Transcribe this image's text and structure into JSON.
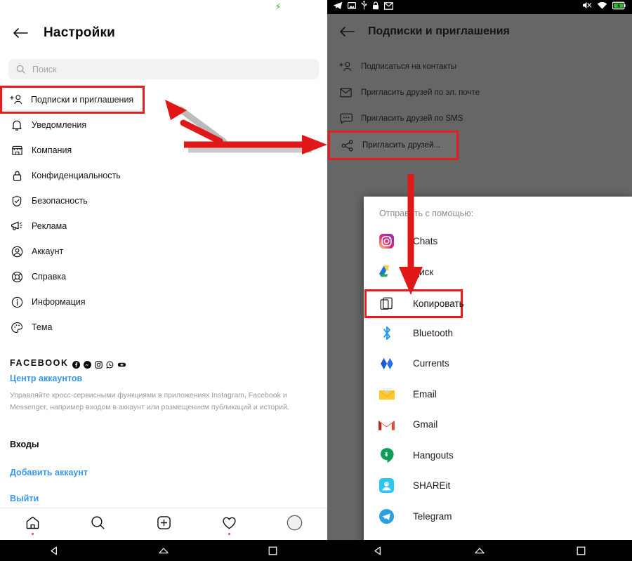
{
  "left_panel": {
    "status_bar": {
      "charge_icon": "charging-bolt-icon"
    },
    "header": {
      "back_icon": "back-arrow-icon",
      "title": "Настройки"
    },
    "search": {
      "icon": "search-icon",
      "placeholder": "Поиск"
    },
    "menu_items": [
      {
        "icon": "add-person-icon",
        "label": "Подписки и приглашения",
        "highlighted": true
      },
      {
        "icon": "bell-icon",
        "label": "Уведомления"
      },
      {
        "icon": "store-icon",
        "label": "Компания"
      },
      {
        "icon": "lock-icon",
        "label": "Конфиденциальность"
      },
      {
        "icon": "shield-check-icon",
        "label": "Безопасность"
      },
      {
        "icon": "megaphone-icon",
        "label": "Реклама"
      },
      {
        "icon": "account-circle-icon",
        "label": "Аккаунт"
      },
      {
        "icon": "lifebuoy-icon",
        "label": "Справка"
      },
      {
        "icon": "info-circle-icon",
        "label": "Информация"
      },
      {
        "icon": "palette-icon",
        "label": "Тема"
      }
    ],
    "facebook": {
      "word": "FACEBOOK",
      "brand_icons": [
        "facebook-icon",
        "messenger-icon",
        "instagram-icon",
        "whatsapp-icon",
        "oculus-icon"
      ],
      "link": "Центр аккаунтов",
      "description": "Управляйте кросс-сервисными функциями в приложениях Instagram, Facebook и Messenger, например входом в аккаунт или размещением публикаций и историй."
    },
    "logins": {
      "heading": "Входы",
      "add_account": "Добавить аккаунт",
      "logout": "Выйти"
    },
    "tabbar": [
      {
        "icon": "home-icon",
        "badge": true
      },
      {
        "icon": "search-icon",
        "badge": false
      },
      {
        "icon": "plus-square-icon",
        "badge": false
      },
      {
        "icon": "heart-icon",
        "badge": true
      },
      {
        "icon": "avatar-icon",
        "badge": false
      }
    ],
    "navbar": [
      {
        "icon": "android-back-icon"
      },
      {
        "icon": "android-home-icon"
      },
      {
        "icon": "android-recents-icon"
      }
    ]
  },
  "right_panel": {
    "status_bar": {
      "left_icons": [
        "telegram-icon",
        "screenshot-icon",
        "usb-icon",
        "lock-icon",
        "gmail-icon"
      ],
      "right_icons": [
        "mute-icon",
        "wifi-icon",
        "battery-charging-icon"
      ]
    },
    "header": {
      "back_icon": "back-arrow-icon",
      "title": "Подписки и приглашения"
    },
    "menu_items": [
      {
        "icon": "add-person-icon",
        "label": "Подписаться на контакты",
        "highlighted": false
      },
      {
        "icon": "envelope-icon",
        "label": "Пригласить друзей по эл. почте",
        "highlighted": false
      },
      {
        "icon": "sms-bubble-icon",
        "label": "Пригласить друзей по SMS",
        "highlighted": false
      },
      {
        "icon": "share-icon",
        "label": "Пригласить друзей...",
        "highlighted": true
      }
    ],
    "share_dialog": {
      "title": "Отправить с помощью:",
      "items": [
        {
          "icon": "instagram-icon",
          "label": "Chats",
          "highlighted": false
        },
        {
          "icon": "google-drive-icon",
          "label": "Диск",
          "highlighted": false
        },
        {
          "icon": "copy-icon",
          "label": "Копировать",
          "highlighted": true
        },
        {
          "icon": "bluetooth-icon",
          "label": "Bluetooth",
          "highlighted": false
        },
        {
          "icon": "currents-icon",
          "label": "Currents",
          "highlighted": false
        },
        {
          "icon": "email-icon",
          "label": "Email",
          "highlighted": false
        },
        {
          "icon": "gmail-icon",
          "label": "Gmail",
          "highlighted": false
        },
        {
          "icon": "hangouts-icon",
          "label": "Hangouts",
          "highlighted": false
        },
        {
          "icon": "shareit-icon",
          "label": "SHAREit",
          "highlighted": false
        },
        {
          "icon": "telegram-icon",
          "label": "Telegram",
          "highlighted": false
        }
      ]
    },
    "navbar": [
      {
        "icon": "android-back-icon"
      },
      {
        "icon": "android-home-icon"
      },
      {
        "icon": "android-recents-icon"
      }
    ]
  },
  "annotations": {
    "highlight_color": "#e81c1c",
    "arrows": [
      {
        "name": "arrow-to-subscriptions",
        "direction": "up-left"
      },
      {
        "name": "arrow-to-invite-friends",
        "direction": "right"
      },
      {
        "name": "arrow-to-copy",
        "direction": "down"
      }
    ]
  }
}
